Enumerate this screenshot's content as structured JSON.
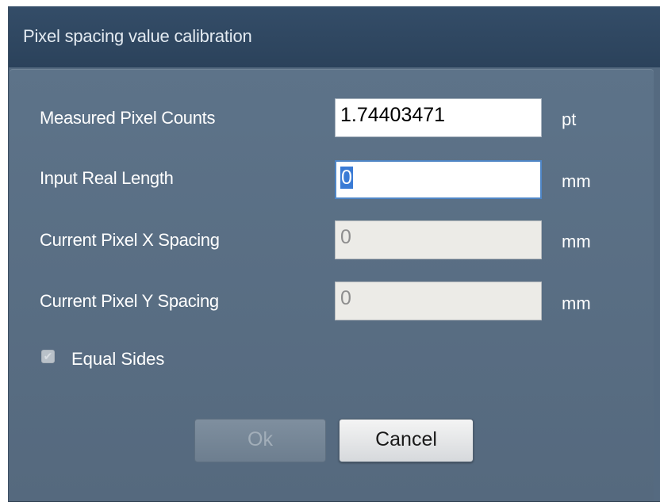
{
  "dialog": {
    "title": "Pixel spacing value calibration"
  },
  "fields": {
    "measured_pixel_counts": {
      "label": "Measured Pixel Counts",
      "value": "1.74403471",
      "unit": "pt"
    },
    "input_real_length": {
      "label": "Input Real Length",
      "value": "0",
      "unit": "mm"
    },
    "current_pixel_x_spacing": {
      "label": "Current Pixel X Spacing",
      "value": "0",
      "unit": "mm"
    },
    "current_pixel_y_spacing": {
      "label": "Current Pixel Y Spacing",
      "value": "0",
      "unit": "mm"
    }
  },
  "equal_sides": {
    "label": "Equal Sides",
    "checked": true,
    "icon": "checkmark-icon"
  },
  "buttons": {
    "ok_label": "Ok",
    "cancel_label": "Cancel"
  },
  "colors": {
    "titlebar": "#2f4760",
    "panel": "#5a6f85",
    "focus_border": "#4f86c6",
    "selection": "#3a7bd5",
    "disabled_field": "#ecebe7"
  }
}
